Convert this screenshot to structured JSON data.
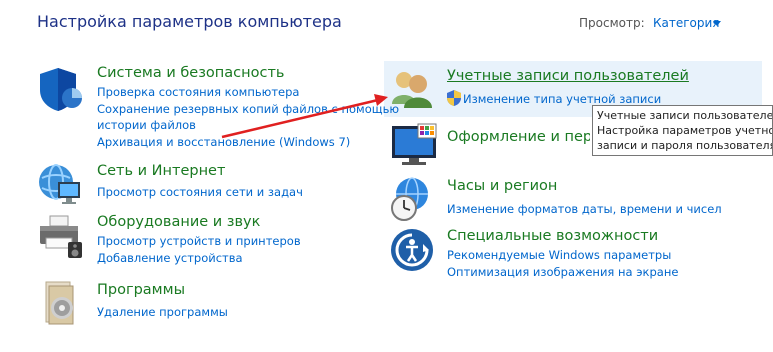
{
  "header": {
    "title": "Настройка параметров компьютера",
    "view_label": "Просмотр:",
    "view_value": "Категория"
  },
  "left": {
    "system": {
      "title": "Система и безопасность",
      "links": [
        "Проверка состояния компьютера",
        "Сохранение резервных копий файлов с помощью",
        "истории файлов",
        "Архивация и восстановление (Windows 7)"
      ]
    },
    "network": {
      "title": "Сеть и Интернет",
      "links": [
        "Просмотр состояния сети и задач"
      ]
    },
    "hardware": {
      "title": "Оборудование и звук",
      "links": [
        "Просмотр устройств и принтеров",
        "Добавление устройства"
      ]
    },
    "programs": {
      "title": "Программы",
      "links": [
        "Удаление программы"
      ]
    }
  },
  "right": {
    "accounts": {
      "title": "Учетные записи пользователей",
      "links": [
        "Изменение типа учетной записи"
      ]
    },
    "appearance": {
      "title": "Оформление и персонализация"
    },
    "clock": {
      "title": "Часы и регион",
      "links": [
        "Изменение форматов даты, времени и чисел"
      ]
    },
    "access": {
      "title": "Специальные возможности",
      "links": [
        "Рекомендуемые Windows параметры",
        "Оптимизация изображения на экране"
      ]
    }
  },
  "tooltip": {
    "lines": [
      "Учетные записи пользователей",
      "Настройка параметров учетной",
      "записи и пароля пользователя."
    ]
  },
  "colors": {
    "category_green": "#1a7a22",
    "link_blue": "#0066cc",
    "title_blue": "#1e3287",
    "arrow_red": "#e02020"
  }
}
